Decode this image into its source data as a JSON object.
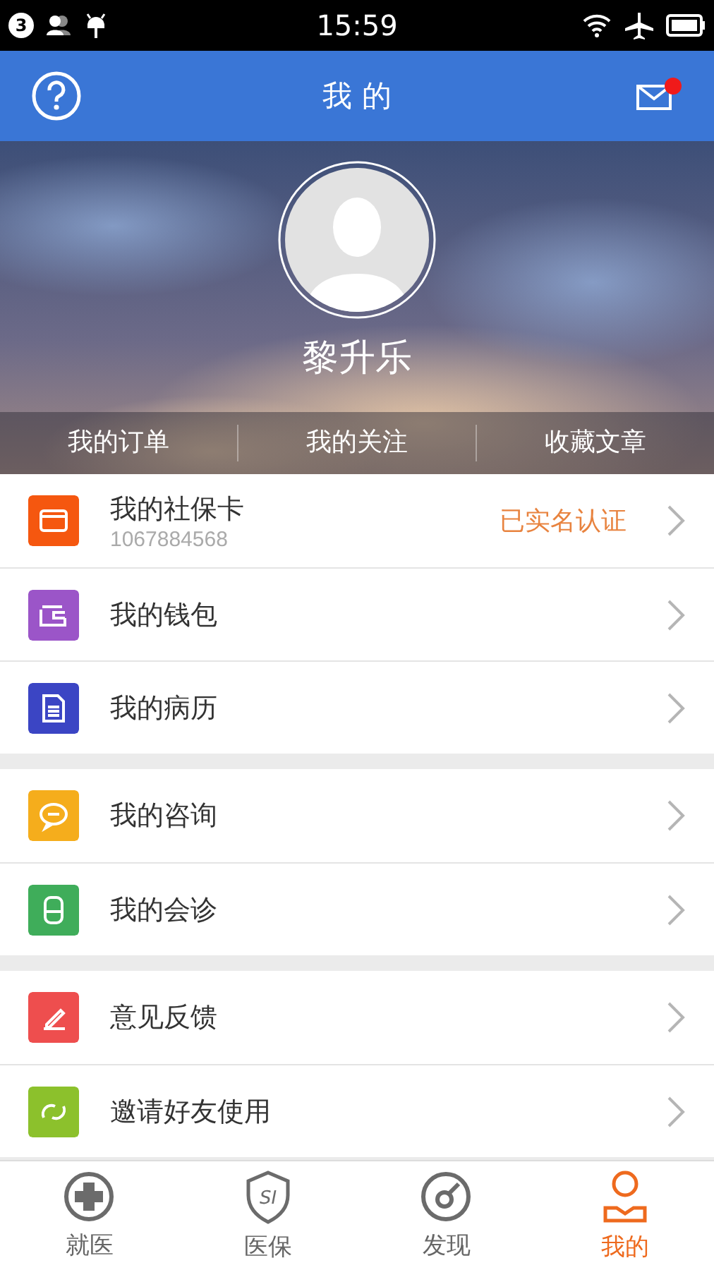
{
  "status_bar": {
    "notification_count": "3",
    "time": "15:59"
  },
  "header": {
    "title": "我 的",
    "has_unread_mail": true
  },
  "profile": {
    "name": "黎升乐",
    "links": [
      "我的订单",
      "我的关注",
      "收藏文章"
    ]
  },
  "menu_groups": [
    {
      "items": [
        {
          "kind": "card",
          "color": "#f5570f",
          "label": "我的社保卡",
          "subtitle": "1067884568",
          "status": "已实名认证"
        },
        {
          "kind": "wallet",
          "color": "#9b55c8",
          "label": "我的钱包"
        },
        {
          "kind": "document",
          "color": "#3b45c4",
          "label": "我的病历"
        }
      ]
    },
    {
      "items": [
        {
          "kind": "chat",
          "color": "#f5ad1c",
          "label": "我的咨询"
        },
        {
          "kind": "person",
          "color": "#3fad5a",
          "label": "我的会诊"
        }
      ]
    },
    {
      "items": [
        {
          "kind": "pen",
          "color": "#ee4e4e",
          "label": "意见反馈"
        },
        {
          "kind": "share",
          "color": "#8cc12c",
          "label": "邀请好友使用"
        }
      ]
    }
  ],
  "tabs": [
    {
      "kind": "cross",
      "label": "就医",
      "selected": false
    },
    {
      "kind": "shield",
      "label": "医保",
      "icon_text": "SI",
      "selected": false
    },
    {
      "kind": "discover",
      "label": "发现",
      "selected": false
    },
    {
      "kind": "user",
      "label": "我的",
      "selected": true
    }
  ]
}
